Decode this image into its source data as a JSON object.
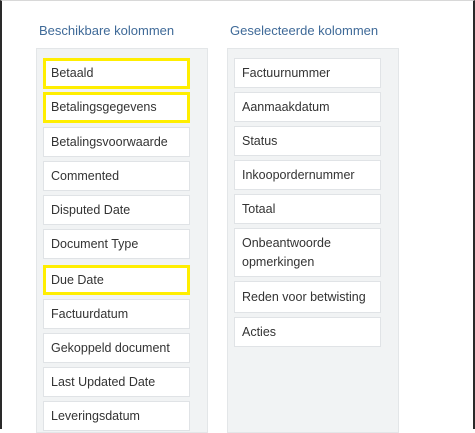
{
  "available": {
    "header": "Beschikbare kolommen",
    "items": [
      {
        "label": "Betaald"
      },
      {
        "label": "Betalingsgegevens"
      },
      {
        "label": "Betalingsvoorwaarde"
      },
      {
        "label": "Commented"
      },
      {
        "label": "Disputed Date"
      },
      {
        "label": "Document Type"
      },
      {
        "label": "Due Date"
      },
      {
        "label": "Factuurdatum"
      },
      {
        "label": "Gekoppeld document"
      },
      {
        "label": "Last Updated Date"
      },
      {
        "label": "Leveringsdatum"
      }
    ]
  },
  "selected": {
    "header": "Geselecteerde kolommen",
    "items": [
      {
        "label": "Factuurnummer"
      },
      {
        "label": "Aanmaakdatum"
      },
      {
        "label": "Status"
      },
      {
        "label": "Inkoopordernummer"
      },
      {
        "label": "Totaal"
      },
      {
        "label": "Onbeantwoorde opmerkingen"
      },
      {
        "label": "Reden voor betwisting"
      },
      {
        "label": "Acties"
      }
    ]
  },
  "highlight_color": "#ffee00"
}
